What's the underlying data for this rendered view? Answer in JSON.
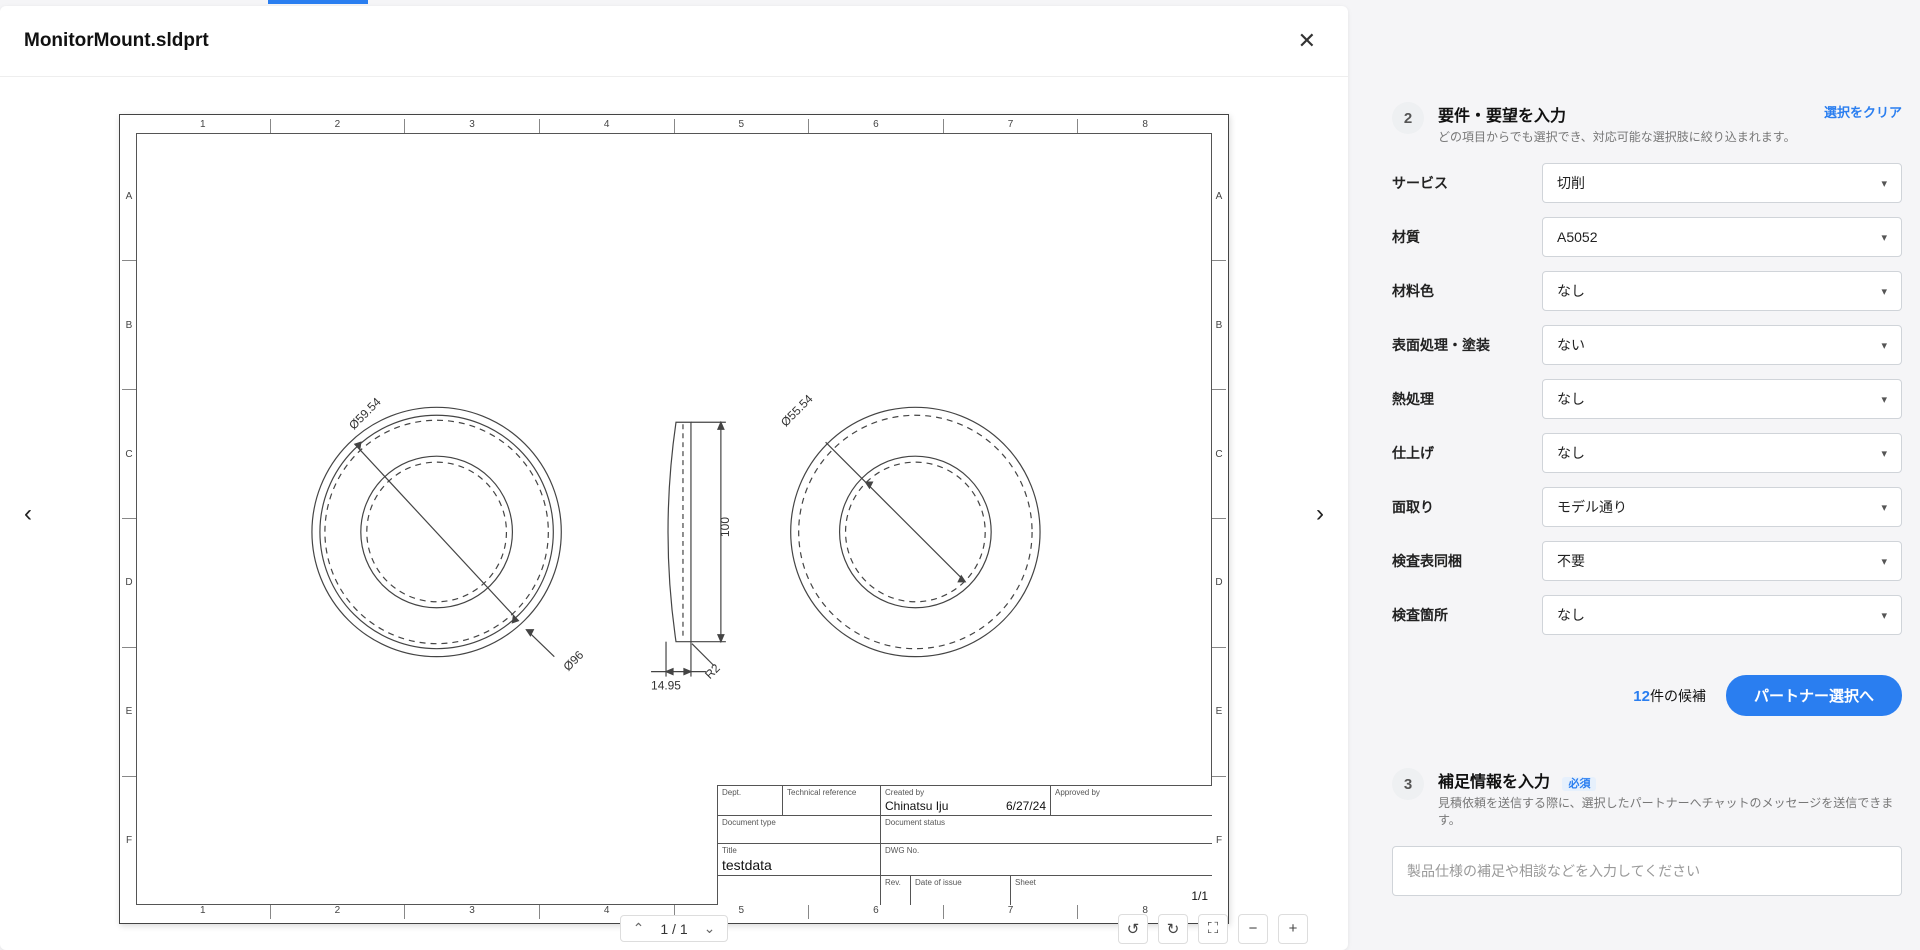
{
  "document": {
    "title": "MonitorMount.sldprt"
  },
  "drawing": {
    "ruler_cols": [
      "1",
      "2",
      "3",
      "4",
      "5",
      "6",
      "7",
      "8"
    ],
    "ruler_rows": [
      "A",
      "B",
      "C",
      "D",
      "E",
      "F"
    ],
    "dimensions": {
      "d1": "Ø59.54",
      "d2": "Ø96",
      "d3": "Ø55.54",
      "d4": "100",
      "d5": "14.95",
      "d6": "R2"
    },
    "title_block": {
      "dept_label": "Dept.",
      "techref_label": "Technical reference",
      "createdby_label": "Created by",
      "createdby_value": "Chinatsu Iju",
      "date_value": "6/27/24",
      "approvedby_label": "Approved by",
      "doctype_label": "Document type",
      "docstatus_label": "Document status",
      "title_label": "Title",
      "title_value": "testdata",
      "dwgno_label": "DWG No.",
      "rev_label": "Rev.",
      "dateissue_label": "Date of issue",
      "sheet_label": "Sheet",
      "sheet_value": "1/1"
    }
  },
  "viewer": {
    "page_text": "1 / 1"
  },
  "step2": {
    "title": "要件・要望を入力",
    "description": "どの項目からでも選択でき、対応可能な選択肢に絞り込まれます。",
    "clear": "選択をクリア",
    "fields": [
      {
        "label": "サービス",
        "value": "切削"
      },
      {
        "label": "材質",
        "value": "A5052"
      },
      {
        "label": "材料色",
        "value": "なし"
      },
      {
        "label": "表面処理・塗装",
        "value": "ない"
      },
      {
        "label": "熱処理",
        "value": "なし"
      },
      {
        "label": "仕上げ",
        "value": "なし"
      },
      {
        "label": "面取り",
        "value": "モデル通り"
      },
      {
        "label": "検査表同梱",
        "value": "不要"
      },
      {
        "label": "検査箇所",
        "value": "なし"
      }
    ]
  },
  "footer": {
    "count": "12",
    "count_suffix": "件の候補",
    "button": "パートナー選択へ"
  },
  "step3": {
    "title": "補足情報を入力",
    "required": "必須",
    "description": "見積依頼を送信する際に、選択したパートナーへチャットのメッセージを送信できます。",
    "placeholder": "製品仕様の補足や相談などを入力してください"
  }
}
